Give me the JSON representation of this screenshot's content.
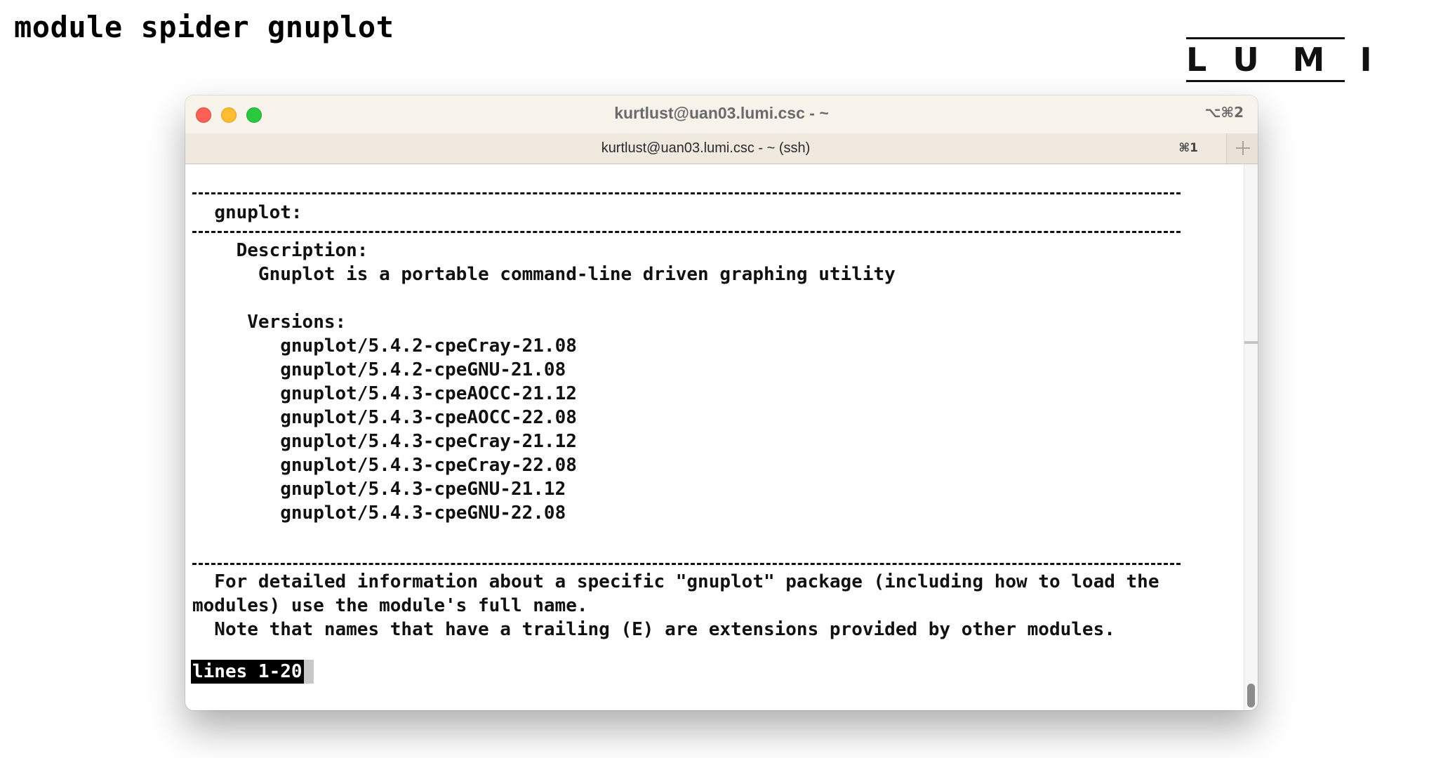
{
  "slide": {
    "title": "module spider gnuplot"
  },
  "logo": {
    "letters": [
      "L",
      "U",
      "M",
      "I"
    ]
  },
  "terminal": {
    "window_title": "kurtlust@uan03.lumi.csc - ~",
    "window_shortcut": "⌥⌘2",
    "tab": {
      "label": "kurtlust@uan03.lumi.csc - ~ (ssh)",
      "shortcut": "⌘1"
    },
    "new_tab_icon": "plus-icon",
    "traffic_lights": {
      "close_color": "#fe5f57",
      "minimize_color": "#febc2e",
      "zoom_color": "#28c840"
    },
    "output": {
      "module_header": "gnuplot:",
      "description_label": "Description:",
      "description_text": "Gnuplot is a portable command-line driven graphing utility",
      "versions_label": "Versions:",
      "versions": [
        "gnuplot/5.4.2-cpeCray-21.08",
        "gnuplot/5.4.2-cpeGNU-21.08",
        "gnuplot/5.4.3-cpeAOCC-21.12",
        "gnuplot/5.4.3-cpeAOCC-22.08",
        "gnuplot/5.4.3-cpeCray-21.12",
        "gnuplot/5.4.3-cpeCray-22.08",
        "gnuplot/5.4.3-cpeGNU-21.12",
        "gnuplot/5.4.3-cpeGNU-22.08"
      ],
      "footer_lines": [
        "  For detailed information about a specific \"gnuplot\" package (including how to load the",
        "modules) use the module's full name.",
        "  Note that names that have a trailing (E) are extensions provided by other modules."
      ],
      "pager_status": "lines 1-20"
    }
  }
}
